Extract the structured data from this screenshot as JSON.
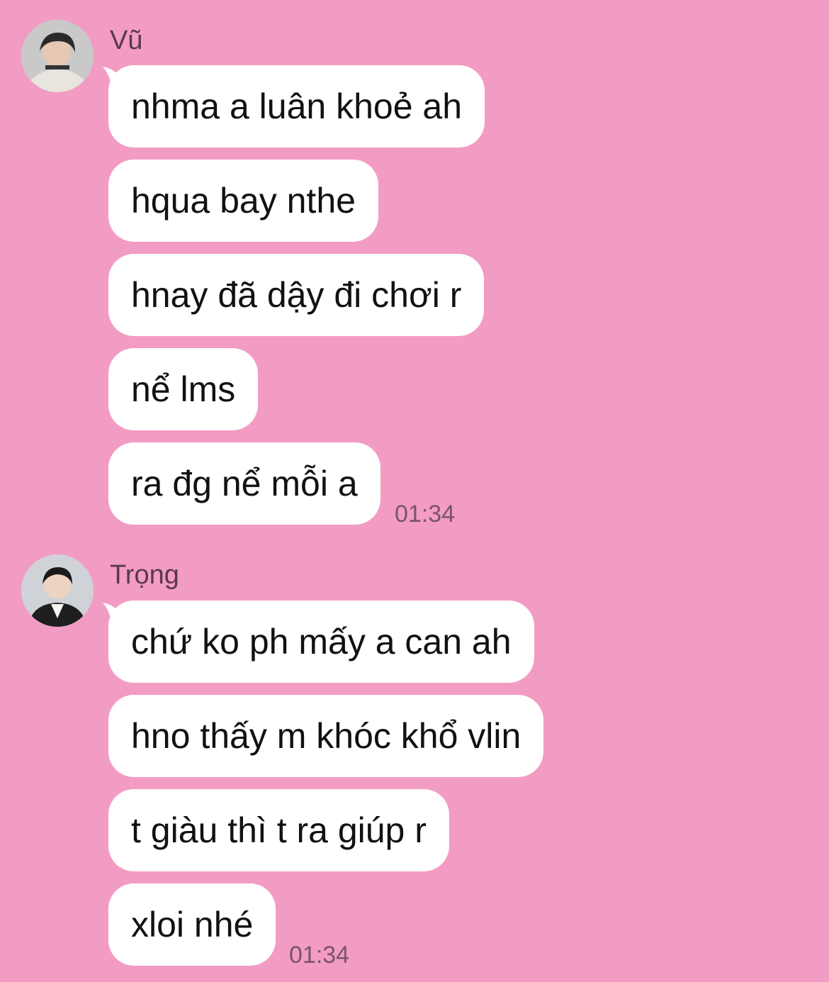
{
  "groups": [
    {
      "sender": "Vũ",
      "messages": [
        "nhma a luân khoẻ ah",
        "hqua bay nthe",
        "hnay đã dậy đi chơi r",
        "nể lms",
        "ra đg nể mỗi a"
      ],
      "timestamp": "01:34"
    },
    {
      "sender": "Trọng",
      "messages": [
        "chứ ko ph mấy a can ah",
        "hno thấy m khóc khổ vlin",
        "t giàu thì t ra giúp r",
        "xloi nhé"
      ],
      "timestamp": "01:34"
    }
  ],
  "colors": {
    "background": "#f39cc3",
    "bubble": "#ffffff",
    "text": "#111111",
    "meta": "#7a5566"
  }
}
